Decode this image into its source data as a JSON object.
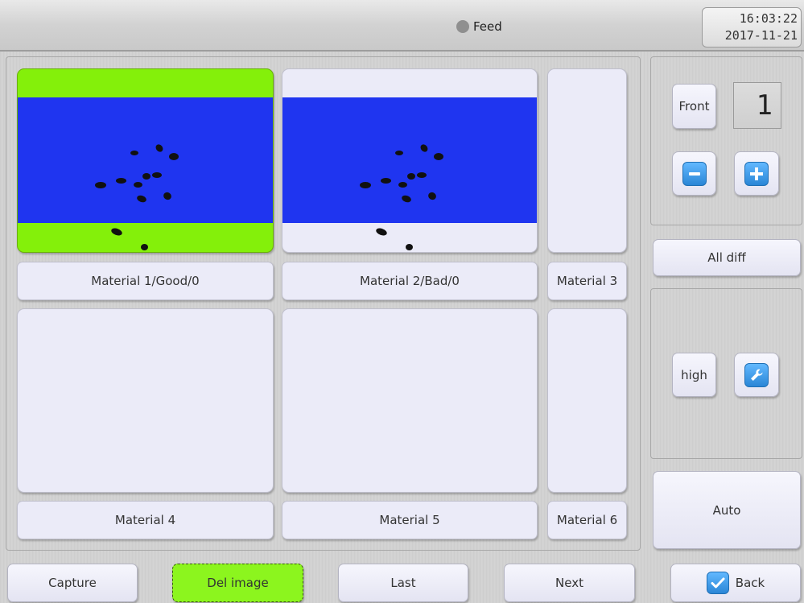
{
  "header": {
    "status_label": "Feed",
    "status_color": "#8f8f8f",
    "time": "16:03:22",
    "date": "2017-11-21"
  },
  "materials": {
    "m1": "Material 1/Good/0",
    "m2": "Material 2/Bad/0",
    "m3": "Material 3",
    "m4": "Material 4",
    "m5": "Material 5",
    "m6": "Material 6"
  },
  "side": {
    "front_label": "Front",
    "counter_value": "1",
    "minus_icon": "minus-icon",
    "plus_icon": "plus-icon",
    "all_diff_label": "All diff",
    "high_label": "high",
    "wrench_icon": "wrench-icon",
    "auto_label": "Auto"
  },
  "bottom": {
    "capture_label": "Capture",
    "del_image_label": "Del image",
    "last_label": "Last",
    "next_label": "Next",
    "back_label": "Back",
    "back_icon": "check-icon"
  },
  "colors": {
    "image_blue": "#1f35f0",
    "image_green": "#84f00a",
    "del_image_green": "#8cf51e",
    "icon_blue": "#2a86d6",
    "tile_bg": "#ebebf8"
  }
}
